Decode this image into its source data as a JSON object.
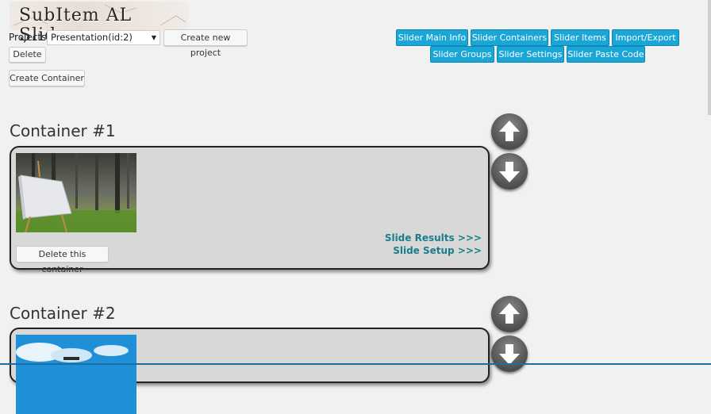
{
  "app": {
    "logo_text": "SubItem AL Slider"
  },
  "projects": {
    "label": "Projects",
    "selected": "Presentation(id:2)",
    "create_button": "Create new project",
    "delete_button": "Delete"
  },
  "create_container_button": "Create Container",
  "nav": {
    "row1": [
      "Slider Main Info",
      "Slider Containers",
      "Slider Items",
      "Import/Export"
    ],
    "row2": [
      "Slider Groups",
      "Slider Settings",
      "Slider Paste Code"
    ]
  },
  "containers": [
    {
      "title": "Container #1",
      "delete_button": "Delete this container",
      "link_results": "Slide Results >>>",
      "link_setup": "Slide Setup >>>"
    },
    {
      "title": "Container #2"
    }
  ],
  "colors": {
    "nav_button": "#1aa7d8",
    "link": "#1a7d8a",
    "panel": "#d8d8d8"
  }
}
